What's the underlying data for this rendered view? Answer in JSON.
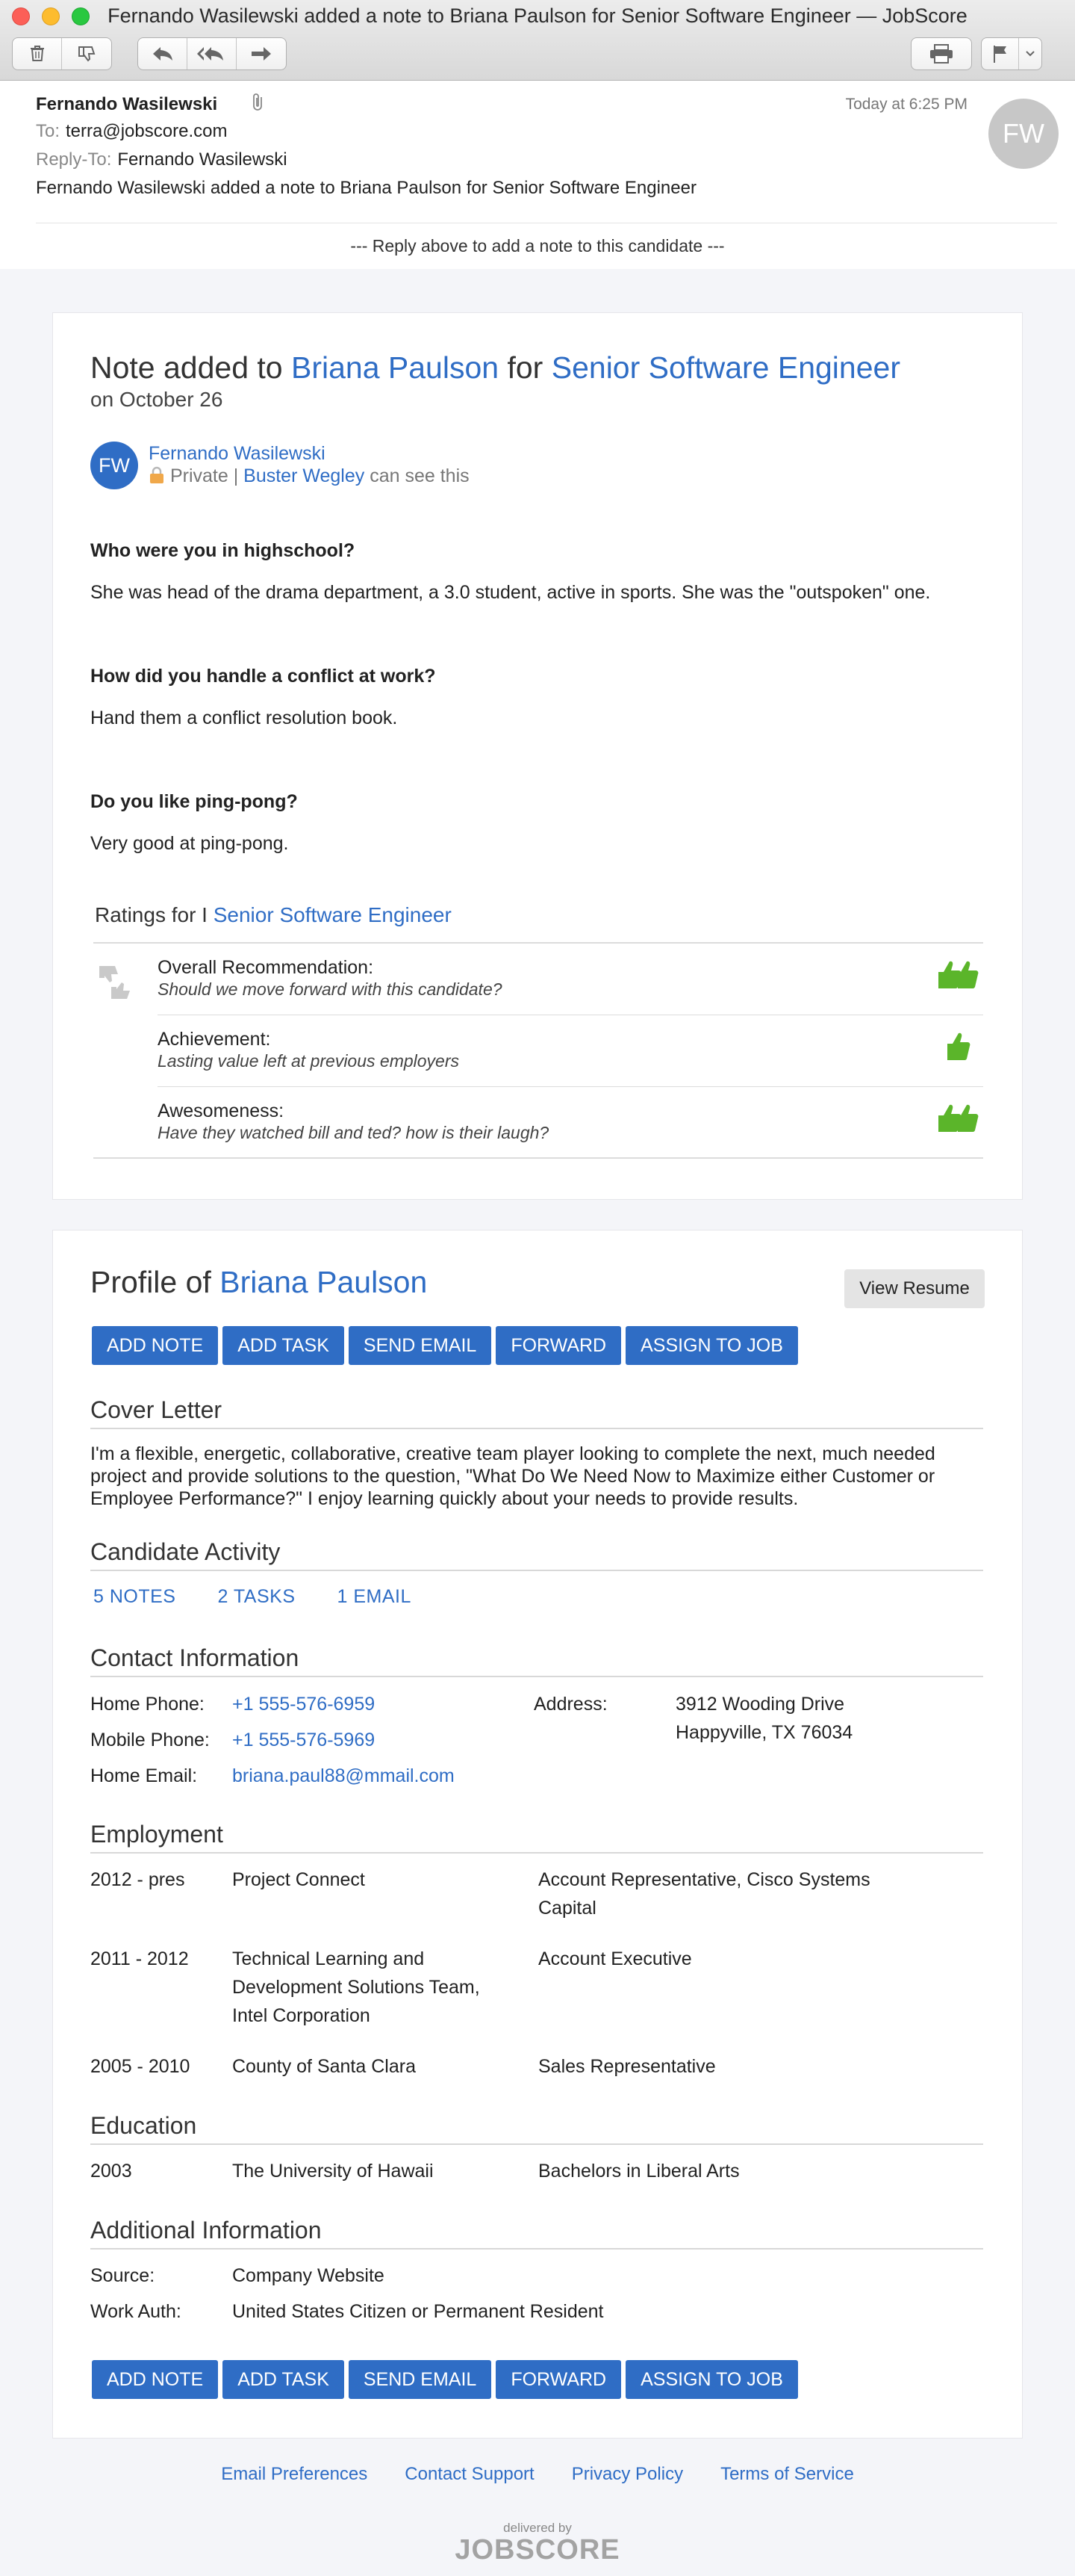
{
  "window": {
    "title": "Fernando Wasilewski added a note to Briana Paulson for Senior Software Engineer — JobScore"
  },
  "mail": {
    "from": "Fernando Wasilewski",
    "to_label": "To:",
    "to": "terra@jobscore.com",
    "reply_to_label": "Reply-To:",
    "reply_to": "Fernando Wasilewski",
    "subject": "Fernando Wasilewski added a note to Briana Paulson for Senior Software Engineer",
    "date": "Today at 6:25 PM",
    "avatar_initials": "FW",
    "reply_hint": "--- Reply above to add a note to this candidate ---"
  },
  "note": {
    "title_prefix": "Note added to",
    "candidate": "Briana Paulson",
    "for_word": "for",
    "job": "Senior Software Engineer",
    "date": "on October 26",
    "author_initials": "FW",
    "author": "Fernando Wasilewski",
    "privacy": "Private |",
    "visible_to": "Buster Wegley",
    "visibility_suffix": "can see this",
    "qa": [
      {
        "q": "Who were you in highschool?",
        "a": "She was head of the drama department, a 3.0 student, active in sports. She was the \"outspoken\" one."
      },
      {
        "q": "How did you handle a conflict at work?",
        "a": "Hand them a conflict resolution book."
      },
      {
        "q": "Do you like ping-pong?",
        "a": "Very good at ping-pong."
      }
    ],
    "ratings_prefix": "Ratings for I",
    "ratings_job": "Senior Software Engineer",
    "ratings": [
      {
        "label": "Overall Recommendation:",
        "sub": "Should we move forward with this candidate?",
        "thumbs": 2
      },
      {
        "label": "Achievement:",
        "sub": "Lasting value left at previous employers",
        "thumbs": 1
      },
      {
        "label": "Awesomeness:",
        "sub": "Have they watched bill and ted? how is their laugh?",
        "thumbs": 2
      }
    ],
    "colors": {
      "link": "#2f6dc5",
      "thumb_green": "#5bb52a"
    }
  },
  "profile": {
    "title_prefix": "Profile of",
    "candidate": "Briana Paulson",
    "view_resume": "View Resume",
    "buttons": [
      "ADD NOTE",
      "ADD TASK",
      "SEND EMAIL",
      "FORWARD",
      "ASSIGN TO JOB"
    ],
    "cover_letter_title": "Cover Letter",
    "cover_letter": "I'm a flexible, energetic, collaborative, creative team player looking to complete the next, much needed project and provide solutions to the question, \"What Do We Need Now to Maximize either Customer or Employee Performance?\" I enjoy learning quickly about your needs to provide results.",
    "activity_title": "Candidate Activity",
    "activity": [
      "5 NOTES",
      "2 TASKS",
      "1 EMAIL"
    ],
    "contact_title": "Contact Information",
    "contact": {
      "home_phone_label": "Home Phone:",
      "home_phone": "+1 555-576-6959",
      "mobile_phone_label": "Mobile Phone:",
      "mobile_phone": "+1 555-576-5969",
      "home_email_label": "Home Email:",
      "home_email": "briana.paul88@mmail.com",
      "address_label": "Address:",
      "address_line1": "3912 Wooding Drive",
      "address_line2": "Happyville, TX 76034"
    },
    "employment_title": "Employment",
    "employment": [
      {
        "years": "2012 - pres",
        "org": "Project Connect",
        "role": "Account Representative, Cisco Systems Capital"
      },
      {
        "years": "2011 - 2012",
        "org": "Technical Learning and Development Solutions Team, Intel Corporation",
        "role": "Account Executive"
      },
      {
        "years": "2005 - 2010",
        "org": "County of Santa Clara",
        "role": "Sales Representative"
      }
    ],
    "education_title": "Education",
    "education": [
      {
        "year": "2003",
        "school": "The University of Hawaii",
        "degree": "Bachelors in Liberal Arts"
      }
    ],
    "additional_title": "Additional Information",
    "source_label": "Source:",
    "source": "Company Website",
    "work_auth_label": "Work Auth:",
    "work_auth": "United States Citizen or Permanent Resident"
  },
  "footer": {
    "links": [
      "Email Preferences",
      "Contact Support",
      "Privacy Policy",
      "Terms of Service"
    ],
    "delivered_by": "delivered by",
    "logo": "JOBSCORE"
  }
}
